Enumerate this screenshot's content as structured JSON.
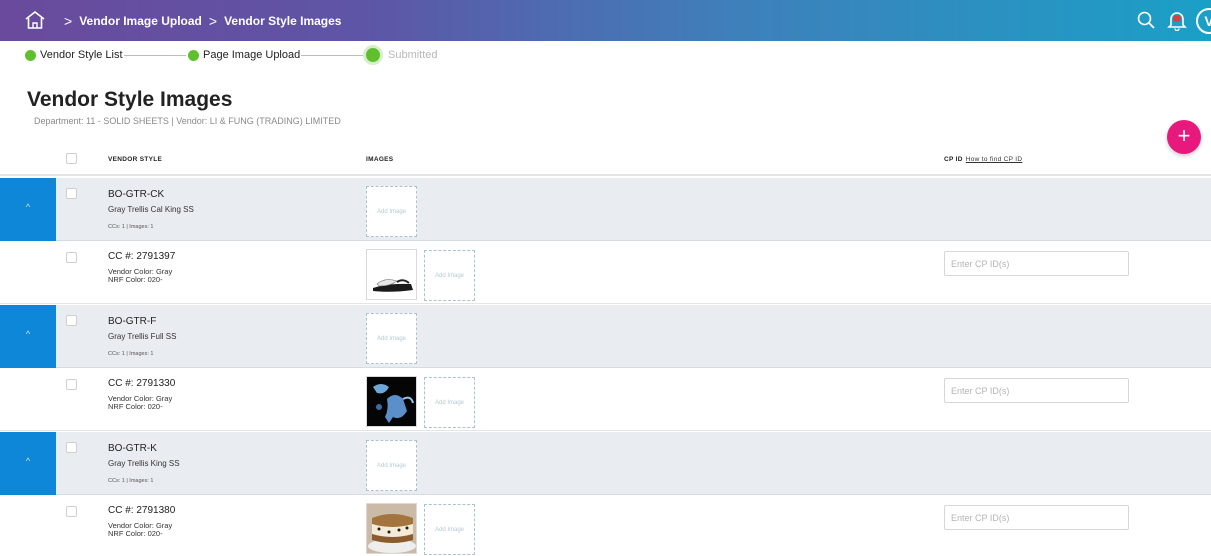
{
  "topbar": {
    "breadcrumbs": [
      "Vendor Image Upload",
      "Vendor Style Images"
    ],
    "sep": ">",
    "avatar_letter": "V"
  },
  "stepper": [
    {
      "label": "Vendor Style List",
      "state": "done"
    },
    {
      "label": "Page Image Upload",
      "state": "done"
    },
    {
      "label": "Submitted",
      "state": "pending"
    }
  ],
  "page": {
    "title": "Vendor Style Images",
    "subtitle": "Department: 11 - SOLID SHEETS | Vendor: LI & FUNG (TRADING) LIMITED",
    "add_label": "+"
  },
  "table": {
    "col_vendor_style": "VENDOR STYLE",
    "col_images": "IMAGES",
    "col_cp_id": "CP ID",
    "cp_help_link": "How to find CP ID",
    "add_image_label": "Add Image",
    "cp_placeholder": "Enter CP ID(s)",
    "expand_icon": "^",
    "groups": [
      {
        "style": "BO-GTR-CK",
        "desc": "Gray Trellis Cal King SS",
        "meta": "CCs: 1 | Images: 1",
        "cc": {
          "number": "CC #: 2791397",
          "vendor_color": "Vendor Color: Gray",
          "nrf_color": "NRF Color: 020-",
          "image": "slide-sandal"
        }
      },
      {
        "style": "BO-GTR-F",
        "desc": "Gray Trellis Full SS",
        "meta": "CCs: 1 | Images: 1",
        "cc": {
          "number": "CC #: 2791330",
          "vendor_color": "Vendor Color: Gray",
          "nrf_color": "NRF Color: 020-",
          "image": "blue-figure-on-black"
        }
      },
      {
        "style": "BO-GTR-K",
        "desc": "Gray Trellis King SS",
        "meta": "CCs: 1 | Images: 1",
        "cc": {
          "number": "CC #: 2791380",
          "vendor_color": "Vendor Color: Gray",
          "nrf_color": "NRF Color: 020-",
          "image": "ice-cream-sandwich"
        }
      }
    ]
  }
}
